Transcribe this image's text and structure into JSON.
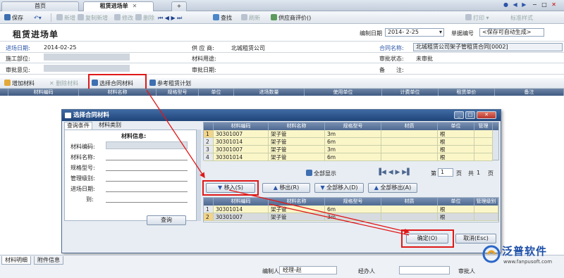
{
  "tabs": {
    "home": "首页",
    "active": "租赁进场单"
  },
  "window_controls": {
    "print": "打印",
    "standard": "标准样式"
  },
  "toolbar": {
    "save": "保存",
    "add": "新增",
    "copy_add": "复制新增",
    "edit": "修改",
    "delete": "删除",
    "search": "查找",
    "refresh": "刷新",
    "supplier_eval": "供应商评价()"
  },
  "header": {
    "title": "租赁进场单",
    "edit_date_label": "编制日期",
    "edit_date_value": "2014- 2-25",
    "doc_no_label": "单据编号",
    "doc_no_value": "<保存可自动生成>"
  },
  "form": {
    "entry_date_label": "进场日期:",
    "entry_date_value": "2014-02-25",
    "supplier_label": "供 应 商:",
    "supplier_value": "北城租赁公司",
    "contract_label": "合同名称:",
    "contract_value": "北城租赁公司架子管租赁合同[0002]",
    "construction_unit_label": "施工部位:",
    "construction_unit_value": "",
    "material_use_label": "材料用途:",
    "approval_status_label": "审批状态:",
    "approval_status_value": "未审批",
    "approval_opinion_label": "审批意见:",
    "approval_date_label": "审批日期:",
    "remark_label": "备　　注:"
  },
  "subtoolbar": {
    "add_material": "增加材料",
    "delete_material": "删除材料",
    "select_contract_material": "选择合同材料",
    "reference_plan": "参考租赁计划"
  },
  "grid_columns": [
    "材料编码",
    "材料名称",
    "规格型号",
    "单位",
    "进场数量",
    "使用单位",
    "计费单位",
    "租赁单价",
    "备注"
  ],
  "dialog": {
    "title": "选择合同材料",
    "tabs": [
      "查询条件",
      "材料类别"
    ],
    "info_title": "材料信息:",
    "fields": [
      "材料编码:",
      "材料名称:",
      "规格型号:",
      "管理级别:",
      "进场日期:",
      "到:"
    ],
    "query_button": "查询",
    "upper_columns": [
      "材料编码",
      "材料名称",
      "规格型号",
      "材质",
      "单位",
      "管理"
    ],
    "upper_rows": [
      {
        "no": "1",
        "code": "30301007",
        "name": "架子管",
        "spec": "3m",
        "material": "",
        "unit": "根"
      },
      {
        "no": "2",
        "code": "30301014",
        "name": "架子管",
        "spec": "6m",
        "material": "",
        "unit": "根"
      },
      {
        "no": "3",
        "code": "30301007",
        "name": "架子管",
        "spec": "3m",
        "material": "",
        "unit": "根"
      },
      {
        "no": "4",
        "code": "30301014",
        "name": "架子管",
        "spec": "6m",
        "material": "",
        "unit": "根"
      }
    ],
    "show_all": "全部显示",
    "page_label": "第",
    "page_value": "1",
    "page_unit": "页",
    "total_label": "共",
    "total_value": "1",
    "total_unit": "页",
    "move_in": "移入(S)",
    "move_out": "移出(R)",
    "move_all_in": "全部移入(D)",
    "move_all_out": "全部移出(A)",
    "lower_columns": [
      "材料编码",
      "材料名称",
      "规格型号",
      "材质",
      "单位",
      "管理级别"
    ],
    "lower_rows": [
      {
        "no": "1",
        "code": "30301014",
        "name": "架子管",
        "spec": "6m",
        "material": "",
        "unit": "根"
      },
      {
        "no": "2",
        "code": "30301007",
        "name": "架子管",
        "spec": "3m",
        "material": "",
        "unit": "根"
      }
    ],
    "ok_button": "确定(O)",
    "cancel_button": "取消(Esc)"
  },
  "footer": {
    "tab_detail": "材料明细",
    "tab_attachment": "附件信息",
    "creator_label": "编制人",
    "creator_value": "经理-赵",
    "handler_label": "经办人",
    "approver_label": "审批人"
  },
  "logo": {
    "text": "泛普软件",
    "url": "www.fanpusoft.com"
  },
  "colors": {
    "accent": "#2a55a8",
    "highlight": "#e01818",
    "grid_header": "#4d6890",
    "row_highlight": "#fbf6c8"
  }
}
